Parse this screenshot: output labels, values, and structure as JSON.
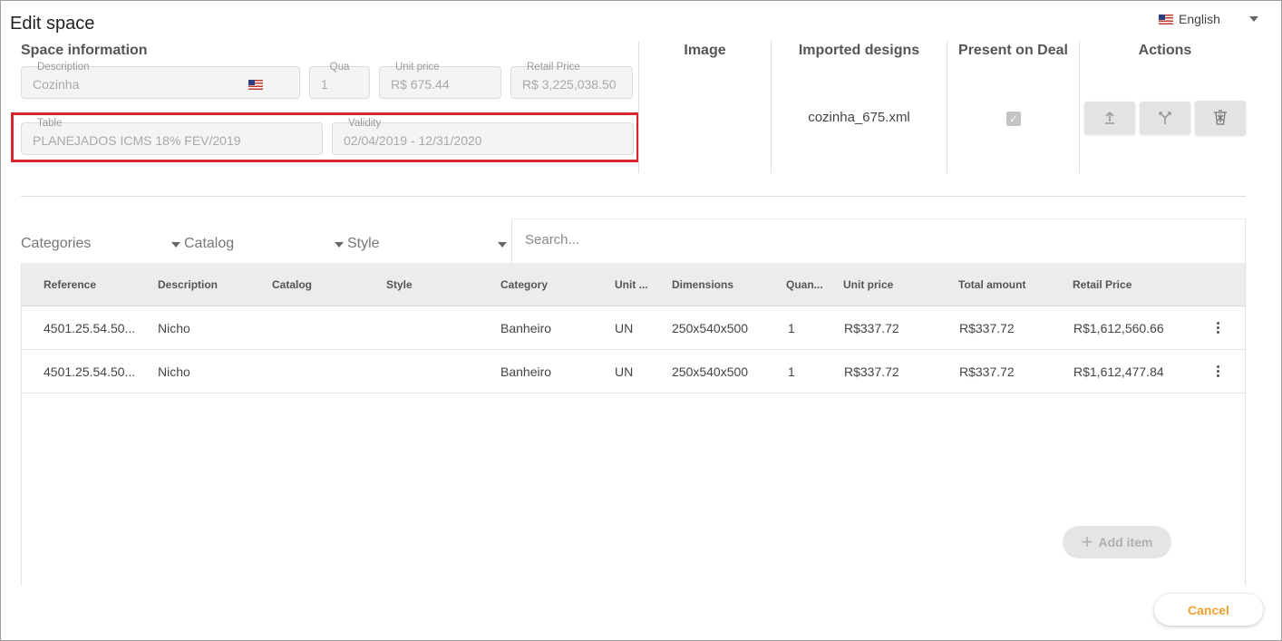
{
  "window": {
    "title": "Edit space"
  },
  "language": {
    "selected": "English",
    "flag_icon": "us-flag-icon"
  },
  "space_info": {
    "heading": "Space information",
    "description": {
      "label": "Description",
      "value": "Cozinha"
    },
    "quantity": {
      "label": "Qua",
      "value": "1"
    },
    "unit_price": {
      "label": "Unit price",
      "value": "R$ 675.44"
    },
    "retail_price": {
      "label": "Retail Price",
      "value": "R$ 3,225,038.50"
    },
    "table": {
      "label": "Table",
      "value": "PLANEJADOS ICMS 18% FEV/2019"
    },
    "validity": {
      "label": "Validity",
      "value": "02/04/2019 - 12/31/2020"
    }
  },
  "columns": {
    "image": "Image",
    "imported_designs": "Imported designs",
    "present_on_deal": "Present on Deal",
    "actions": "Actions"
  },
  "imported_file": "cozinha_675.xml",
  "present_checked": true,
  "action_icons": [
    "upload-icon",
    "merge-icon",
    "trash-icon"
  ],
  "filters": {
    "categories": "Categories",
    "catalog": "Catalog",
    "style": "Style",
    "search_placeholder": "Search..."
  },
  "items_table": {
    "headers": [
      "Reference",
      "Description",
      "Catalog",
      "Style",
      "Category",
      "Unit ...",
      "Dimensions",
      "Quan...",
      "Unit price",
      "Total amount",
      "Retail Price"
    ],
    "rows": [
      [
        "4501.25.54.50...",
        "Nicho",
        "",
        "",
        "Banheiro",
        "UN",
        "250x540x500",
        "1",
        "R$337.72",
        "R$337.72",
        "R$1,612,560.66"
      ],
      [
        "4501.25.54.50...",
        "Nicho",
        "",
        "",
        "Banheiro",
        "UN",
        "250x540x500",
        "1",
        "R$337.72",
        "R$337.72",
        "R$1,612,477.84"
      ]
    ]
  },
  "buttons": {
    "add_item": "Add item",
    "cancel": "Cancel"
  },
  "colors": {
    "highlight": "#d9262c",
    "cancel_text": "#f0a030"
  }
}
